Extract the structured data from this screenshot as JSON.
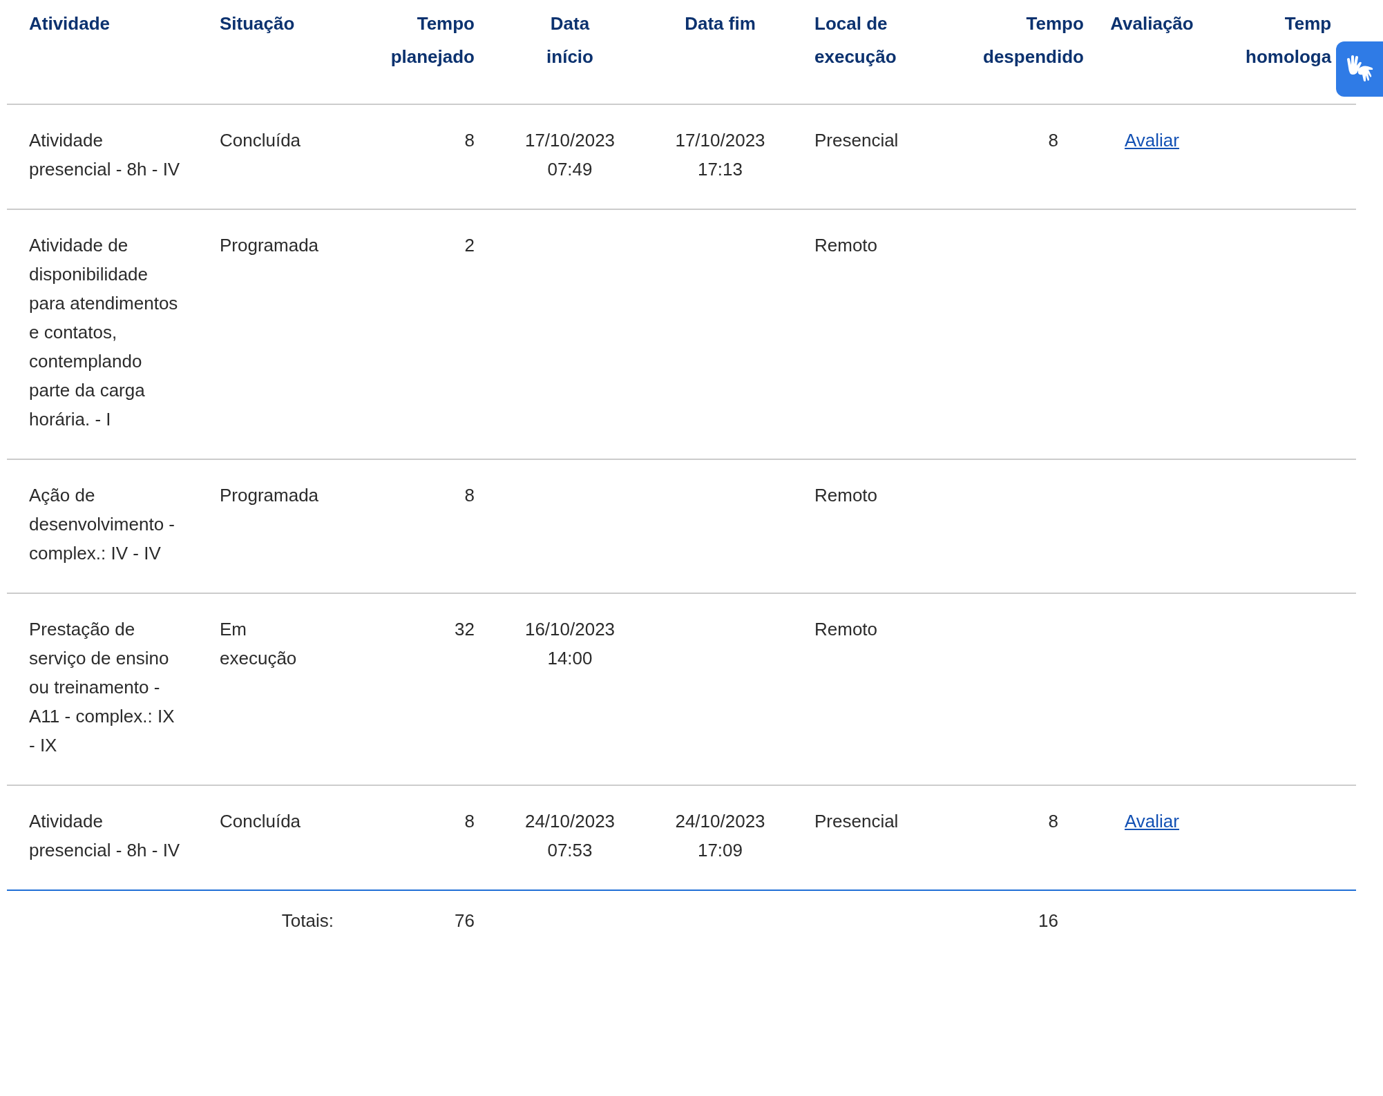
{
  "table": {
    "columns": [
      "Atividade",
      "Situação",
      "Tempo planejado",
      "Data início",
      "Data fim",
      "Local de execução",
      "Tempo despendido",
      "Avaliação",
      "Temp homologa"
    ],
    "rows": [
      {
        "atividade": "Atividade presencial - 8h - IV",
        "situacao": "Concluída",
        "tempo_planejado": "8",
        "data_inicio": "17/10/2023 07:49",
        "data_fim": "17/10/2023 17:13",
        "local": "Presencial",
        "tempo_despendido": "8",
        "avaliacao": "Avaliar"
      },
      {
        "atividade": "Atividade de disponibilidade para atendimentos e contatos, contemplando parte da carga horária. - I",
        "situacao": "Programada",
        "tempo_planejado": "2",
        "local": "Remoto"
      },
      {
        "atividade": "Ação de desenvolvimento - complex.: IV - IV",
        "situacao": "Programada",
        "tempo_planejado": "8",
        "local": "Remoto"
      },
      {
        "atividade": "Prestação de serviço de ensino ou treinamento - A11 - complex.: IX - IX",
        "situacao": "Em execução",
        "tempo_planejado": "32",
        "data_inicio": "16/10/2023 14:00",
        "local": "Remoto"
      },
      {
        "atividade": "Atividade presencial - 8h - IV",
        "situacao": "Concluída",
        "tempo_planejado": "8",
        "data_inicio": "24/10/2023 07:53",
        "data_fim": "24/10/2023 17:09",
        "local": "Presencial",
        "tempo_despendido": "8",
        "avaliacao": "Avaliar"
      }
    ],
    "totals": {
      "label": "Totais:",
      "tempo_planejado": "76",
      "tempo_despendido": "16"
    }
  }
}
